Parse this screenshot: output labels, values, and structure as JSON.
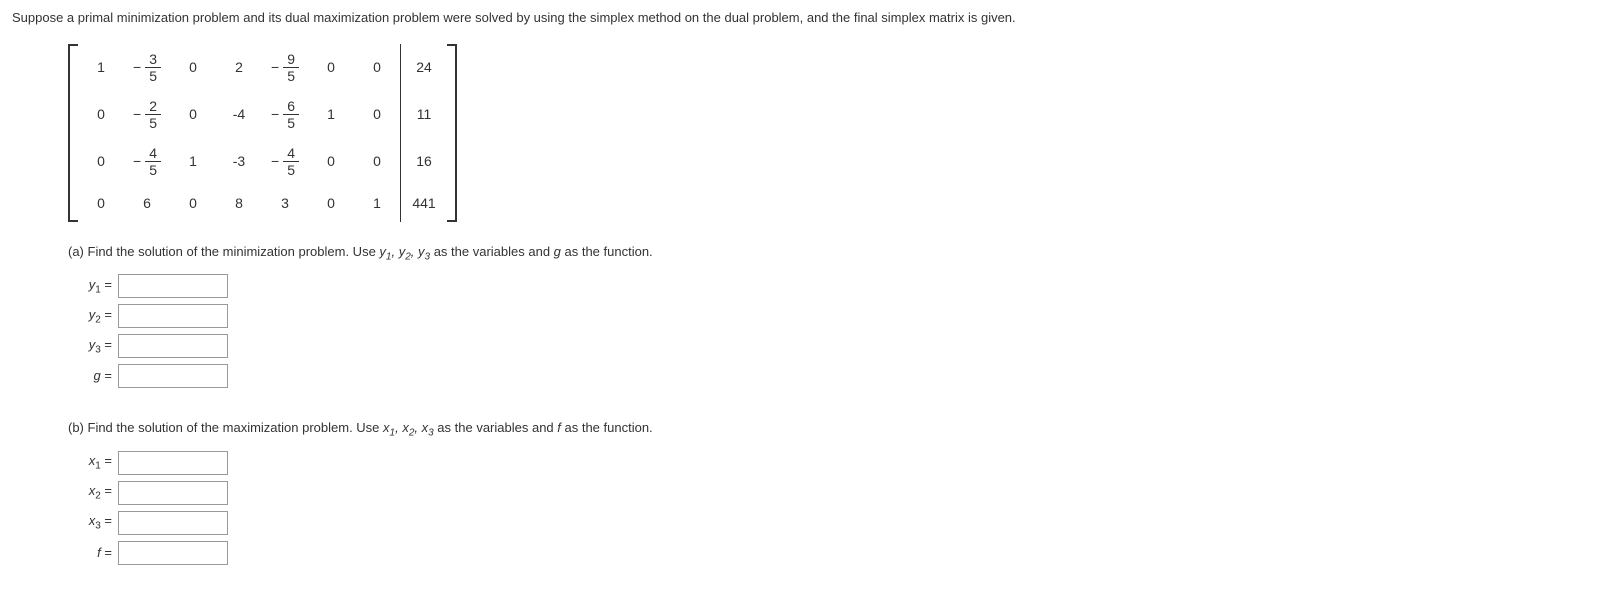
{
  "problem_text": "Suppose a primal minimization problem and its dual maximization problem were solved by using the simplex method on the dual problem, and the final simplex matrix is given.",
  "matrix": {
    "rows": [
      [
        "1",
        {
          "neg": true,
          "num": "3",
          "den": "5"
        },
        "0",
        "2",
        {
          "neg": true,
          "num": "9",
          "den": "5"
        },
        "0",
        "0",
        "24"
      ],
      [
        "0",
        {
          "neg": true,
          "num": "2",
          "den": "5"
        },
        "0",
        "-4",
        {
          "neg": true,
          "num": "6",
          "den": "5"
        },
        "1",
        "0",
        "11"
      ],
      [
        "0",
        {
          "neg": true,
          "num": "4",
          "den": "5"
        },
        "1",
        "-3",
        {
          "neg": true,
          "num": "4",
          "den": "5"
        },
        "0",
        "0",
        "16"
      ],
      [
        "0",
        "6",
        "0",
        "8",
        "3",
        "0",
        "1",
        "441"
      ]
    ]
  },
  "part_a": {
    "text_before": "(a) Find the solution of the minimization problem. Use ",
    "vars_text": "y₁, y₂, y₃",
    "mid_text": " as the variables and ",
    "fn_var": "g",
    "text_after": " as the function.",
    "labels": {
      "y1": "y",
      "y1_sub": "1",
      "y2": "y",
      "y2_sub": "2",
      "y3": "y",
      "y3_sub": "3",
      "g": "g"
    }
  },
  "part_b": {
    "text_before": "(b) Find the solution of the maximization problem. Use ",
    "vars_text": "x₁, x₂, x₃",
    "mid_text": " as the variables and ",
    "fn_var": "f",
    "text_after": " as the function.",
    "labels": {
      "x1": "x",
      "x1_sub": "1",
      "x2": "x",
      "x2_sub": "2",
      "x3": "x",
      "x3_sub": "3",
      "f": "f"
    }
  },
  "equals": "="
}
